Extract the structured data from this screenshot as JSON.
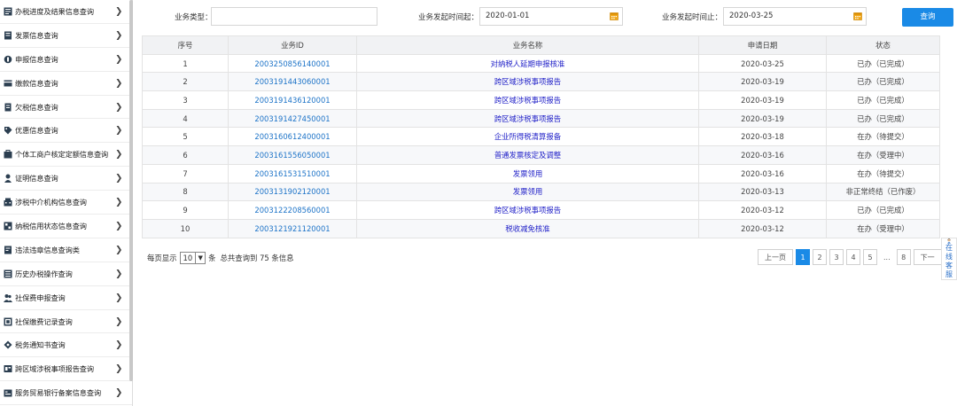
{
  "sidebar": {
    "items": [
      {
        "label": "办税进度及结果信息查询",
        "icon": "progress-icon"
      },
      {
        "label": "发票信息查询",
        "icon": "invoice-icon"
      },
      {
        "label": "申报信息查询",
        "icon": "declare-icon"
      },
      {
        "label": "缴款信息查询",
        "icon": "payment-icon"
      },
      {
        "label": "欠税信息查询",
        "icon": "arrears-icon"
      },
      {
        "label": "优惠信息查询",
        "icon": "discount-icon"
      },
      {
        "label": "个体工商户核定定额信息查询",
        "icon": "business-icon"
      },
      {
        "label": "证明信息查询",
        "icon": "certificate-icon"
      },
      {
        "label": "涉税中介机构信息查询",
        "icon": "agency-icon"
      },
      {
        "label": "纳税信用状态信息查询",
        "icon": "credit-icon"
      },
      {
        "label": "违法违章信息查询类",
        "icon": "violation-icon"
      },
      {
        "label": "历史办税操作查询",
        "icon": "history-icon"
      },
      {
        "label": "社保费申报查询",
        "icon": "social-declare-icon"
      },
      {
        "label": "社保缴费记录查询",
        "icon": "social-record-icon"
      },
      {
        "label": "税务通知书查询",
        "icon": "notice-icon"
      },
      {
        "label": "跨区域涉税事项报告查询",
        "icon": "cross-region-icon"
      },
      {
        "label": "服务贸易银行备案信息查询",
        "icon": "trade-icon"
      }
    ]
  },
  "filter": {
    "type_label": "业务类型：",
    "type_value": "",
    "start_label": "业务发起时间起：",
    "start_value": "2020-01-01",
    "end_label": "业务发起时间止：",
    "end_value": "2020-03-25",
    "query_label": "查询"
  },
  "table": {
    "headers": [
      "序号",
      "业务ID",
      "业务名称",
      "申请日期",
      "状态"
    ],
    "rows": [
      [
        "1",
        "2003250856140001",
        "对纳税人延期申报核准",
        "2020-03-25",
        "已办（已完成）"
      ],
      [
        "2",
        "2003191443060001",
        "跨区域涉税事项报告",
        "2020-03-19",
        "已办（已完成）"
      ],
      [
        "3",
        "2003191436120001",
        "跨区域涉税事项报告",
        "2020-03-19",
        "已办（已完成）"
      ],
      [
        "4",
        "2003191427450001",
        "跨区域涉税事项报告",
        "2020-03-19",
        "已办（已完成）"
      ],
      [
        "5",
        "2003160612400001",
        "企业所得税清算报备",
        "2020-03-18",
        "在办（待提交）"
      ],
      [
        "6",
        "2003161556050001",
        "普通发票核定及调整",
        "2020-03-16",
        "在办（受理中）"
      ],
      [
        "7",
        "2003161531510001",
        "发票领用",
        "2020-03-16",
        "在办（待提交）"
      ],
      [
        "8",
        "2003131902120001",
        "发票领用",
        "2020-03-13",
        "非正常终结（已作废）"
      ],
      [
        "9",
        "2003122208560001",
        "跨区域涉税事项报告",
        "2020-03-12",
        "已办（已完成）"
      ],
      [
        "10",
        "2003121921120001",
        "税收减免核准",
        "2020-03-12",
        "在办（受理中）"
      ]
    ]
  },
  "footer": {
    "per_page_prefix": "每页显示",
    "per_page_value": "10",
    "per_page_suffix": "条",
    "total_text": "总共查询到 75 条信息"
  },
  "pager": {
    "prev": "上一页",
    "pages": [
      "1",
      "2",
      "3",
      "4",
      "5"
    ],
    "dots": "...",
    "last": "8",
    "next": "下一",
    "current": "1"
  },
  "online_service": {
    "text": "在线客服"
  },
  "colors": {
    "accent": "#1a8ae6",
    "link_id": "#1e74c8",
    "link_name": "#2121c8"
  }
}
